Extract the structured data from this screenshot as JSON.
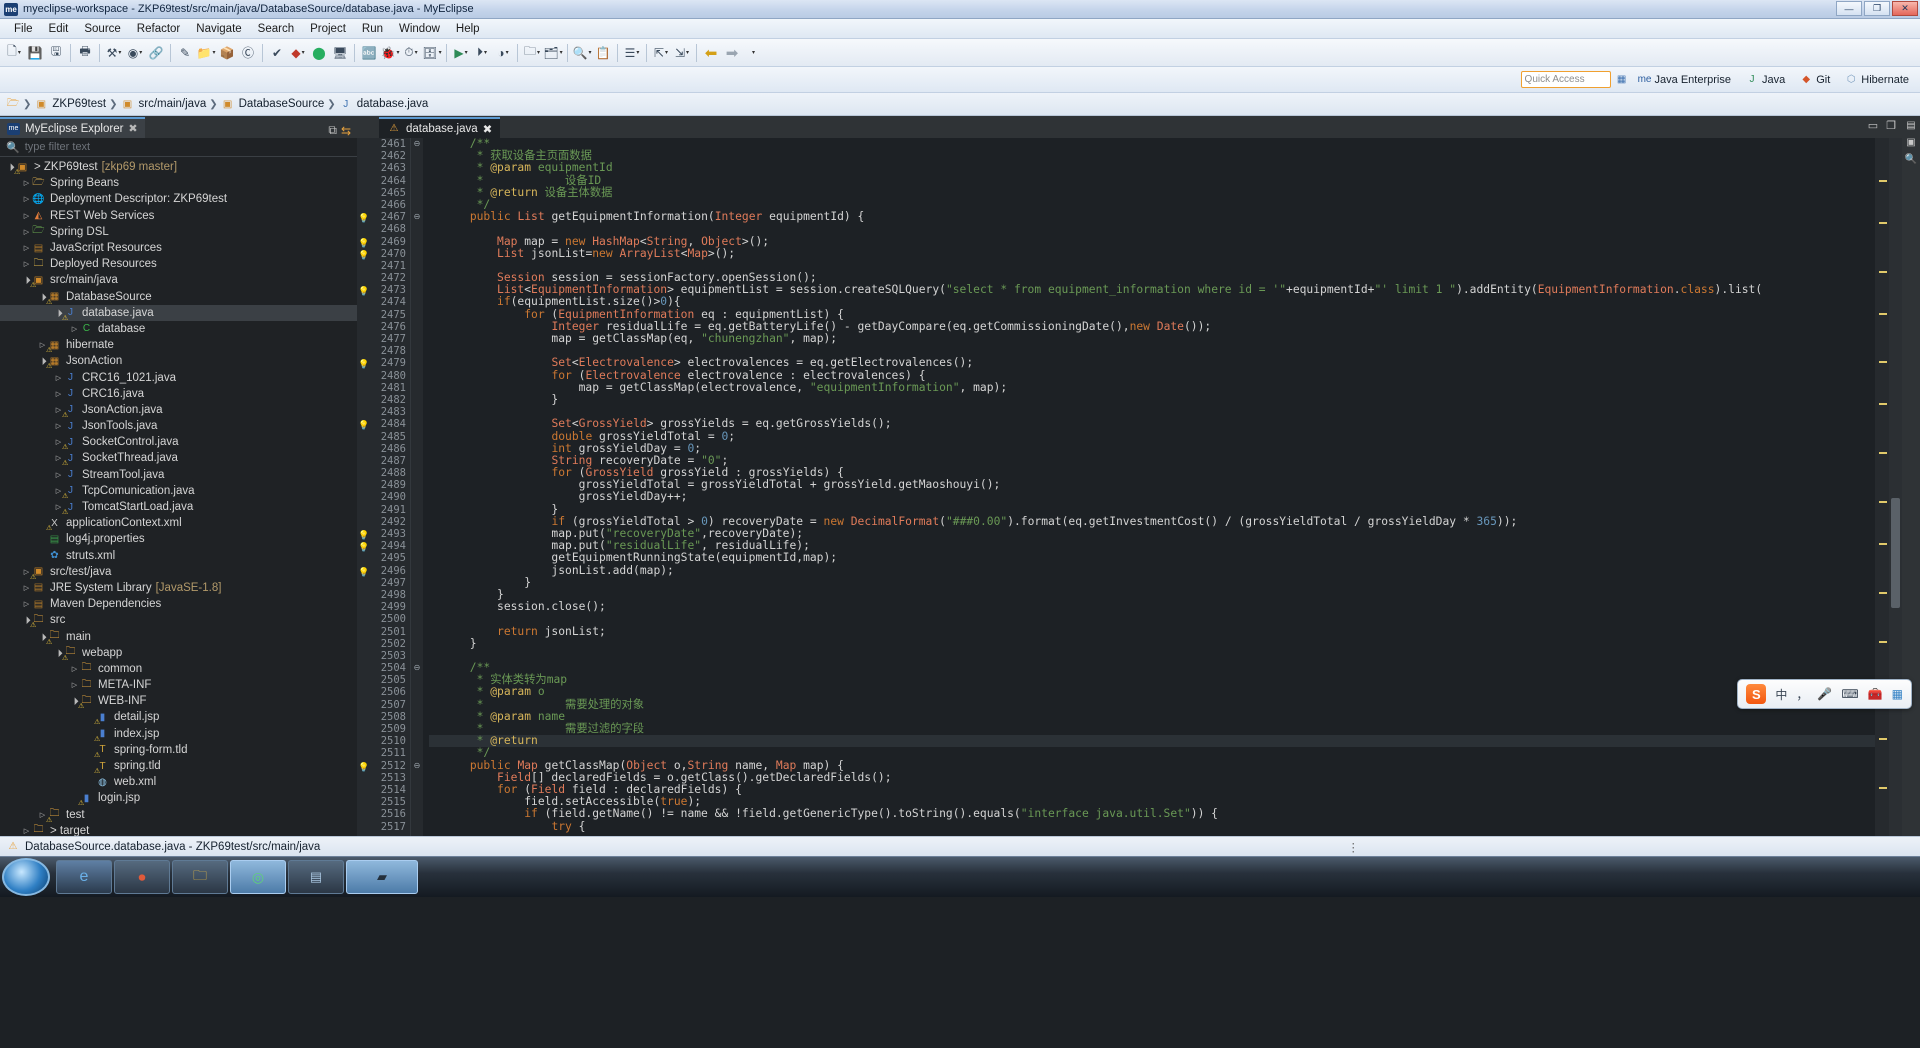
{
  "window": {
    "title": "myeclipse-workspace - ZKP69test/src/main/java/DatabaseSource/database.java - MyEclipse",
    "logo": "me",
    "minimize": "—",
    "maximize": "❐",
    "close": "✕"
  },
  "menubar": [
    "File",
    "Edit",
    "Source",
    "Refactor",
    "Navigate",
    "Search",
    "Project",
    "Run",
    "Window",
    "Help"
  ],
  "toolbar": {
    "groups": [
      [
        "new-icon",
        "save-icon",
        "save-all-icon"
      ],
      [
        "print-icon"
      ],
      [
        "toggle-breakpoint-icon",
        "user-icon",
        "link-icon"
      ],
      [
        "debug-icon",
        "run-icon",
        "run-external-icon",
        "profile-icon",
        "coverage-icon"
      ],
      [
        "myeclipse-icon",
        "deploy-icon",
        "server-icon",
        "database-icon"
      ],
      [
        "new-java-project-icon",
        "new-package-icon",
        "new-class-icon",
        "new-interface-icon"
      ],
      [
        "search-icon",
        "tasks-icon"
      ],
      [
        "outline-toggle-icon"
      ],
      [
        "prev-edit-icon",
        "next-edit-icon"
      ],
      [
        "back-icon",
        "forward-icon"
      ]
    ]
  },
  "perspective": {
    "quick_access_placeholder": "Quick Access",
    "open_perspective_icon": "open-perspective-icon",
    "items": [
      {
        "label": "Java Enterprise",
        "icon": "java-enterprise-icon",
        "active": false
      },
      {
        "label": "Java",
        "icon": "java-icon",
        "active": false
      },
      {
        "label": "Git",
        "icon": "git-icon",
        "active": false
      },
      {
        "label": "Hibernate",
        "icon": "hibernate-icon",
        "active": false
      }
    ]
  },
  "breadcrumb": [
    {
      "label": "",
      "icon": "project-root-icon"
    },
    {
      "label": "ZKP69test",
      "icon": "java-project-icon"
    },
    {
      "label": "src/main/java",
      "icon": "source-folder-icon"
    },
    {
      "label": "DatabaseSource",
      "icon": "package-icon"
    },
    {
      "label": "database.java",
      "icon": "java-file-icon"
    }
  ],
  "explorer": {
    "tab_title": "MyEclipse Explorer",
    "tab_logo": "me",
    "close_icon": "✖",
    "tools": [
      "collapse-all-icon",
      "link-with-editor-icon"
    ],
    "filter_placeholder": "type filter text",
    "filter_value": "",
    "tree": [
      {
        "depth": 0,
        "twisty": "open",
        "icon": "java-project-icon",
        "label": "> ZKP69test",
        "suffix": "[zkp69 master]",
        "selected": false
      },
      {
        "depth": 1,
        "twisty": "closed",
        "icon": "spring-beans-icon",
        "label": "Spring Beans",
        "suffix": "",
        "selected": false
      },
      {
        "depth": 1,
        "twisty": "closed",
        "icon": "deployment-icon",
        "label": "Deployment Descriptor: ZKP69test",
        "suffix": "",
        "selected": false
      },
      {
        "depth": 1,
        "twisty": "closed",
        "icon": "rest-icon",
        "label": "REST Web Services",
        "suffix": "",
        "selected": false
      },
      {
        "depth": 1,
        "twisty": "closed",
        "icon": "spring-dsl-icon",
        "label": "Spring DSL",
        "suffix": "",
        "selected": false
      },
      {
        "depth": 1,
        "twisty": "closed",
        "icon": "js-resources-icon",
        "label": "JavaScript Resources",
        "suffix": "",
        "selected": false
      },
      {
        "depth": 1,
        "twisty": "closed",
        "icon": "deployed-res-icon",
        "label": "Deployed Resources",
        "suffix": "",
        "selected": false
      },
      {
        "depth": 1,
        "twisty": "open",
        "icon": "source-folder-icon",
        "label": "src/main/java",
        "suffix": "",
        "selected": false
      },
      {
        "depth": 2,
        "twisty": "open",
        "icon": "package-icon",
        "label": "DatabaseSource",
        "suffix": "",
        "selected": false
      },
      {
        "depth": 3,
        "twisty": "open",
        "icon": "java-file-warn-icon",
        "label": "database.java",
        "suffix": "",
        "selected": true
      },
      {
        "depth": 4,
        "twisty": "closed",
        "icon": "class-icon",
        "label": "database",
        "suffix": "",
        "selected": false
      },
      {
        "depth": 2,
        "twisty": "closed",
        "icon": "package-icon",
        "label": "hibernate",
        "suffix": "",
        "selected": false
      },
      {
        "depth": 2,
        "twisty": "open",
        "icon": "package-icon",
        "label": "JsonAction",
        "suffix": "",
        "selected": false
      },
      {
        "depth": 3,
        "twisty": "closed",
        "icon": "java-file-icon",
        "label": "CRC16_1021.java",
        "suffix": "",
        "selected": false
      },
      {
        "depth": 3,
        "twisty": "closed",
        "icon": "java-file-icon",
        "label": "CRC16.java",
        "suffix": "",
        "selected": false
      },
      {
        "depth": 3,
        "twisty": "closed",
        "icon": "java-file-warn-icon",
        "label": "JsonAction.java",
        "suffix": "",
        "selected": false
      },
      {
        "depth": 3,
        "twisty": "closed",
        "icon": "java-file-icon",
        "label": "JsonTools.java",
        "suffix": "",
        "selected": false
      },
      {
        "depth": 3,
        "twisty": "closed",
        "icon": "java-file-warn-icon",
        "label": "SocketControl.java",
        "suffix": "",
        "selected": false
      },
      {
        "depth": 3,
        "twisty": "closed",
        "icon": "java-file-warn-icon",
        "label": "SocketThread.java",
        "suffix": "",
        "selected": false
      },
      {
        "depth": 3,
        "twisty": "closed",
        "icon": "java-file-icon",
        "label": "StreamTool.java",
        "suffix": "",
        "selected": false
      },
      {
        "depth": 3,
        "twisty": "closed",
        "icon": "java-file-warn-icon",
        "label": "TcpComunication.java",
        "suffix": "",
        "selected": false
      },
      {
        "depth": 3,
        "twisty": "closed",
        "icon": "java-file-warn-icon",
        "label": "TomcatStartLoad.java",
        "suffix": "",
        "selected": false
      },
      {
        "depth": 2,
        "twisty": "none",
        "icon": "xml-file-icon",
        "label": "applicationContext.xml",
        "suffix": "",
        "selected": false
      },
      {
        "depth": 2,
        "twisty": "none",
        "icon": "properties-icon",
        "label": "log4j.properties",
        "suffix": "",
        "selected": false
      },
      {
        "depth": 2,
        "twisty": "none",
        "icon": "struts-icon",
        "label": "struts.xml",
        "suffix": "",
        "selected": false
      },
      {
        "depth": 1,
        "twisty": "closed",
        "icon": "source-folder-icon",
        "label": "src/test/java",
        "suffix": "",
        "selected": false
      },
      {
        "depth": 1,
        "twisty": "closed",
        "icon": "library-icon",
        "label": "JRE System Library",
        "suffix": "[JavaSE-1.8]",
        "selected": false
      },
      {
        "depth": 1,
        "twisty": "closed",
        "icon": "library-icon",
        "label": "Maven Dependencies",
        "suffix": "",
        "selected": false
      },
      {
        "depth": 1,
        "twisty": "open",
        "icon": "folder-warn-icon",
        "label": "src",
        "suffix": "",
        "selected": false
      },
      {
        "depth": 2,
        "twisty": "open",
        "icon": "folder-warn-icon",
        "label": "main",
        "suffix": "",
        "selected": false
      },
      {
        "depth": 3,
        "twisty": "open",
        "icon": "folder-warn-icon",
        "label": "webapp",
        "suffix": "",
        "selected": false
      },
      {
        "depth": 4,
        "twisty": "closed",
        "icon": "folder-icon",
        "label": "common",
        "suffix": "",
        "selected": false
      },
      {
        "depth": 4,
        "twisty": "closed",
        "icon": "folder-icon",
        "label": "META-INF",
        "suffix": "",
        "selected": false
      },
      {
        "depth": 4,
        "twisty": "open",
        "icon": "folder-warn-icon",
        "label": "WEB-INF",
        "suffix": "",
        "selected": false
      },
      {
        "depth": 5,
        "twisty": "none",
        "icon": "jsp-file-icon",
        "label": "detail.jsp",
        "suffix": "",
        "selected": false
      },
      {
        "depth": 5,
        "twisty": "none",
        "icon": "jsp-file-icon",
        "label": "index.jsp",
        "suffix": "",
        "selected": false
      },
      {
        "depth": 5,
        "twisty": "none",
        "icon": "tld-file-icon",
        "label": "spring-form.tld",
        "suffix": "",
        "selected": false
      },
      {
        "depth": 5,
        "twisty": "none",
        "icon": "tld-file-icon",
        "label": "spring.tld",
        "suffix": "",
        "selected": false
      },
      {
        "depth": 5,
        "twisty": "none",
        "icon": "web-xml-icon",
        "label": "web.xml",
        "suffix": "",
        "selected": false
      },
      {
        "depth": 4,
        "twisty": "none",
        "icon": "jsp-file-icon",
        "label": "login.jsp",
        "suffix": "",
        "selected": false
      },
      {
        "depth": 2,
        "twisty": "closed",
        "icon": "folder-warn-icon",
        "label": "test",
        "suffix": "",
        "selected": false
      },
      {
        "depth": 1,
        "twisty": "closed",
        "icon": "folder-icon",
        "label": "> target",
        "suffix": "",
        "selected": false
      }
    ]
  },
  "editor": {
    "tab_label": "database.java",
    "tab_icon": "java-file-warn-icon",
    "tab_close": "✖",
    "controls": [
      "minimize-icon",
      "maximize-icon"
    ],
    "first_line": 2461,
    "highlighted_line": 2510,
    "lines": [
      {
        "n": 2461,
        "fold": "collapse",
        "marker": "",
        "code": "      /**"
      },
      {
        "n": 2462,
        "fold": "",
        "marker": "",
        "code": "       * 获取设备主页面数据"
      },
      {
        "n": 2463,
        "fold": "",
        "marker": "",
        "code": "       * @param equipmentId"
      },
      {
        "n": 2464,
        "fold": "",
        "marker": "",
        "code": "       *            设备ID"
      },
      {
        "n": 2465,
        "fold": "",
        "marker": "",
        "code": "       * @return 设备主体数据"
      },
      {
        "n": 2466,
        "fold": "",
        "marker": "",
        "code": "       */"
      },
      {
        "n": 2467,
        "fold": "collapse",
        "marker": "bulb",
        "code": "      public List getEquipmentInformation(Integer equipmentId) {"
      },
      {
        "n": 2468,
        "fold": "",
        "marker": "",
        "code": ""
      },
      {
        "n": 2469,
        "fold": "",
        "marker": "bulb",
        "code": "          Map map = new HashMap<String, Object>();"
      },
      {
        "n": 2470,
        "fold": "",
        "marker": "bulb",
        "code": "          List jsonList=new ArrayList<Map>();"
      },
      {
        "n": 2471,
        "fold": "",
        "marker": "",
        "code": ""
      },
      {
        "n": 2472,
        "fold": "",
        "marker": "",
        "code": "          Session session = sessionFactory.openSession();"
      },
      {
        "n": 2473,
        "fold": "",
        "marker": "bulb",
        "code": "          List<EquipmentInformation> equipmentList = session.createSQLQuery(\"select * from equipment_information where id = '\"+equipmentId+\"' limit 1 \").addEntity(EquipmentInformation.class).list("
      },
      {
        "n": 2474,
        "fold": "",
        "marker": "",
        "code": "          if(equipmentList.size()>0){"
      },
      {
        "n": 2475,
        "fold": "",
        "marker": "",
        "code": "              for (EquipmentInformation eq : equipmentList) {"
      },
      {
        "n": 2476,
        "fold": "",
        "marker": "",
        "code": "                  Integer residualLife = eq.getBatteryLife() - getDayCompare(eq.getCommissioningDate(),new Date());"
      },
      {
        "n": 2477,
        "fold": "",
        "marker": "",
        "code": "                  map = getClassMap(eq, \"chunengzhan\", map);"
      },
      {
        "n": 2478,
        "fold": "",
        "marker": "",
        "code": ""
      },
      {
        "n": 2479,
        "fold": "",
        "marker": "bulb",
        "code": "                  Set<Electrovalence> electrovalences = eq.getElectrovalences();"
      },
      {
        "n": 2480,
        "fold": "",
        "marker": "",
        "code": "                  for (Electrovalence electrovalence : electrovalences) {"
      },
      {
        "n": 2481,
        "fold": "",
        "marker": "",
        "code": "                      map = getClassMap(electrovalence, \"equipmentInformation\", map);"
      },
      {
        "n": 2482,
        "fold": "",
        "marker": "",
        "code": "                  }"
      },
      {
        "n": 2483,
        "fold": "",
        "marker": "",
        "code": ""
      },
      {
        "n": 2484,
        "fold": "",
        "marker": "bulb",
        "code": "                  Set<GrossYield> grossYields = eq.getGrossYields();"
      },
      {
        "n": 2485,
        "fold": "",
        "marker": "",
        "code": "                  double grossYieldTotal = 0;"
      },
      {
        "n": 2486,
        "fold": "",
        "marker": "",
        "code": "                  int grossYieldDay = 0;"
      },
      {
        "n": 2487,
        "fold": "",
        "marker": "",
        "code": "                  String recoveryDate = \"0\";"
      },
      {
        "n": 2488,
        "fold": "",
        "marker": "",
        "code": "                  for (GrossYield grossYield : grossYields) {"
      },
      {
        "n": 2489,
        "fold": "",
        "marker": "",
        "code": "                      grossYieldTotal = grossYieldTotal + grossYield.getMaoshouyi();"
      },
      {
        "n": 2490,
        "fold": "",
        "marker": "",
        "code": "                      grossYieldDay++;"
      },
      {
        "n": 2491,
        "fold": "",
        "marker": "",
        "code": "                  }"
      },
      {
        "n": 2492,
        "fold": "",
        "marker": "",
        "code": "                  if (grossYieldTotal > 0) recoveryDate = new DecimalFormat(\"###0.00\").format(eq.getInvestmentCost() / (grossYieldTotal / grossYieldDay * 365));"
      },
      {
        "n": 2493,
        "fold": "",
        "marker": "bulb",
        "code": "                  map.put(\"recoveryDate\",recoveryDate);"
      },
      {
        "n": 2494,
        "fold": "",
        "marker": "bulb",
        "code": "                  map.put(\"residualLife\", residualLife);"
      },
      {
        "n": 2495,
        "fold": "",
        "marker": "",
        "code": "                  getEquipmentRunningState(equipmentId,map);"
      },
      {
        "n": 2496,
        "fold": "",
        "marker": "bulb",
        "code": "                  jsonList.add(map);"
      },
      {
        "n": 2497,
        "fold": "",
        "marker": "",
        "code": "              }"
      },
      {
        "n": 2498,
        "fold": "",
        "marker": "",
        "code": "          }"
      },
      {
        "n": 2499,
        "fold": "",
        "marker": "",
        "code": "          session.close();"
      },
      {
        "n": 2500,
        "fold": "",
        "marker": "",
        "code": ""
      },
      {
        "n": 2501,
        "fold": "",
        "marker": "",
        "code": "          return jsonList;"
      },
      {
        "n": 2502,
        "fold": "",
        "marker": "",
        "code": "      }"
      },
      {
        "n": 2503,
        "fold": "",
        "marker": "",
        "code": ""
      },
      {
        "n": 2504,
        "fold": "collapse",
        "marker": "",
        "code": "      /**"
      },
      {
        "n": 2505,
        "fold": "",
        "marker": "",
        "code": "       * 实体类转为map"
      },
      {
        "n": 2506,
        "fold": "",
        "marker": "",
        "code": "       * @param o"
      },
      {
        "n": 2507,
        "fold": "",
        "marker": "",
        "code": "       *            需要处理的对象"
      },
      {
        "n": 2508,
        "fold": "",
        "marker": "",
        "code": "       * @param name"
      },
      {
        "n": 2509,
        "fold": "",
        "marker": "",
        "code": "       *            需要过滤的字段"
      },
      {
        "n": 2510,
        "fold": "",
        "marker": "",
        "code": "       * @return"
      },
      {
        "n": 2511,
        "fold": "",
        "marker": "",
        "code": "       */"
      },
      {
        "n": 2512,
        "fold": "collapse",
        "marker": "bulb",
        "code": "      public Map getClassMap(Object o,String name, Map map) {"
      },
      {
        "n": 2513,
        "fold": "",
        "marker": "",
        "code": "          Field[] declaredFields = o.getClass().getDeclaredFields();"
      },
      {
        "n": 2514,
        "fold": "",
        "marker": "",
        "code": "          for (Field field : declaredFields) {"
      },
      {
        "n": 2515,
        "fold": "",
        "marker": "",
        "code": "              field.setAccessible(true);"
      },
      {
        "n": 2516,
        "fold": "",
        "marker": "",
        "code": "              if (field.getName() != name && !field.getGenericType().toString().equals(\"interface java.util.Set\")) {"
      },
      {
        "n": 2517,
        "fold": "",
        "marker": "",
        "code": "                  try {"
      }
    ]
  },
  "statusbar": {
    "icon": "java-file-warn-icon",
    "text": "DatabaseSource.database.java - ZKP69test/src/main/java",
    "dots": "⋮"
  },
  "ime": {
    "logo": "S",
    "mode": "中",
    "items": [
      "comma-icon",
      "mic-icon",
      "keyboard-icon",
      "toolbox-icon",
      "grid-icon"
    ]
  },
  "taskbar": {
    "start": "start-orb",
    "items": [
      "ie-icon",
      "media-icon",
      "explorer-icon",
      "chrome-icon",
      "tool-icon",
      "eclipse-icon"
    ]
  },
  "colors": {
    "accent": "#5c9ad2",
    "editor_bg": "#1d2125",
    "gutter_bg": "#262a2e",
    "selection": "#3b4045",
    "warn": "#e8a33d",
    "string": "#6a9955",
    "keyword": "#cc7832"
  }
}
